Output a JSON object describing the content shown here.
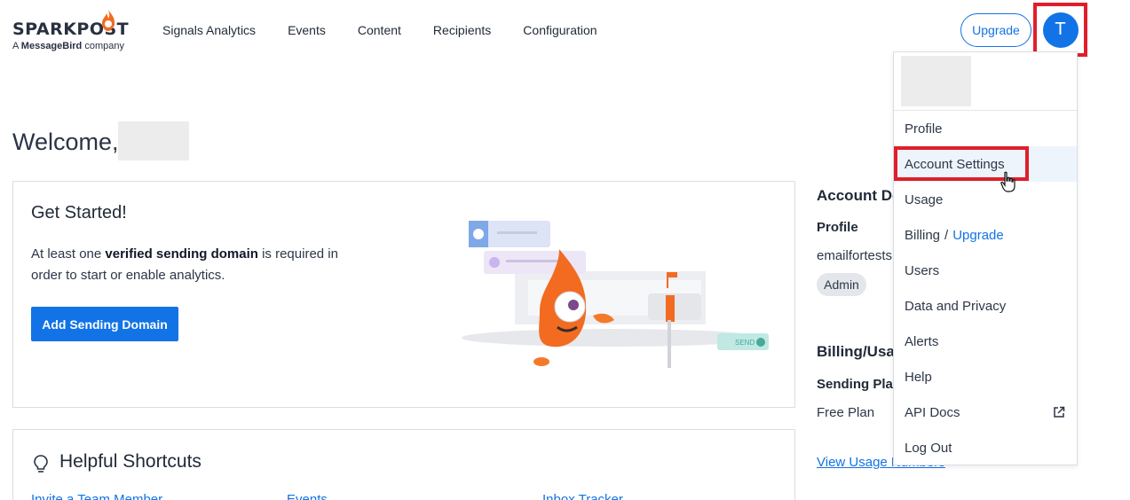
{
  "brand": {
    "wordmark": "SPARKPOST",
    "tagline_prefix": "A",
    "tagline_brand": "MessageBird",
    "tagline_suffix": "company"
  },
  "nav": {
    "items": [
      "Signals Analytics",
      "Events",
      "Content",
      "Recipients",
      "Configuration"
    ]
  },
  "header": {
    "upgrade_label": "Upgrade",
    "avatar_initial": "T"
  },
  "welcome": {
    "greeting": "Welcome,"
  },
  "get_started": {
    "title": "Get Started!",
    "text_before": "At least one ",
    "text_bold": "verified sending domain",
    "text_after": " is required in order to start or enable analytics.",
    "button_label": "Add Sending Domain",
    "illustration_send_label": "SEND"
  },
  "shortcuts": {
    "title": "Helpful Shortcuts",
    "links": [
      "Invite a Team Member",
      "Events",
      "Inbox Tracker"
    ]
  },
  "account": {
    "heading": "Account Details",
    "profile_label": "Profile",
    "email_partial": "emailfortests",
    "role_badge": "Admin",
    "billing_heading": "Billing/Usage",
    "sending_plan_label": "Sending Plan",
    "plan_value": "Free Plan",
    "usage_link": "View Usage Numbers"
  },
  "menu": {
    "items": [
      {
        "label": "Profile"
      },
      {
        "label": "Account Settings"
      },
      {
        "label": "Usage"
      },
      {
        "label": "Billing",
        "extra": "Upgrade"
      },
      {
        "label": "Users"
      },
      {
        "label": "Data and Privacy"
      },
      {
        "label": "Alerts"
      },
      {
        "label": "Help"
      },
      {
        "label": "API Docs",
        "icon": "external-link-icon"
      },
      {
        "label": "Log Out"
      }
    ],
    "separator": "/"
  },
  "colors": {
    "accent": "#1273e6",
    "brand_flame": "#f26b21",
    "highlight": "#e01e2b"
  }
}
